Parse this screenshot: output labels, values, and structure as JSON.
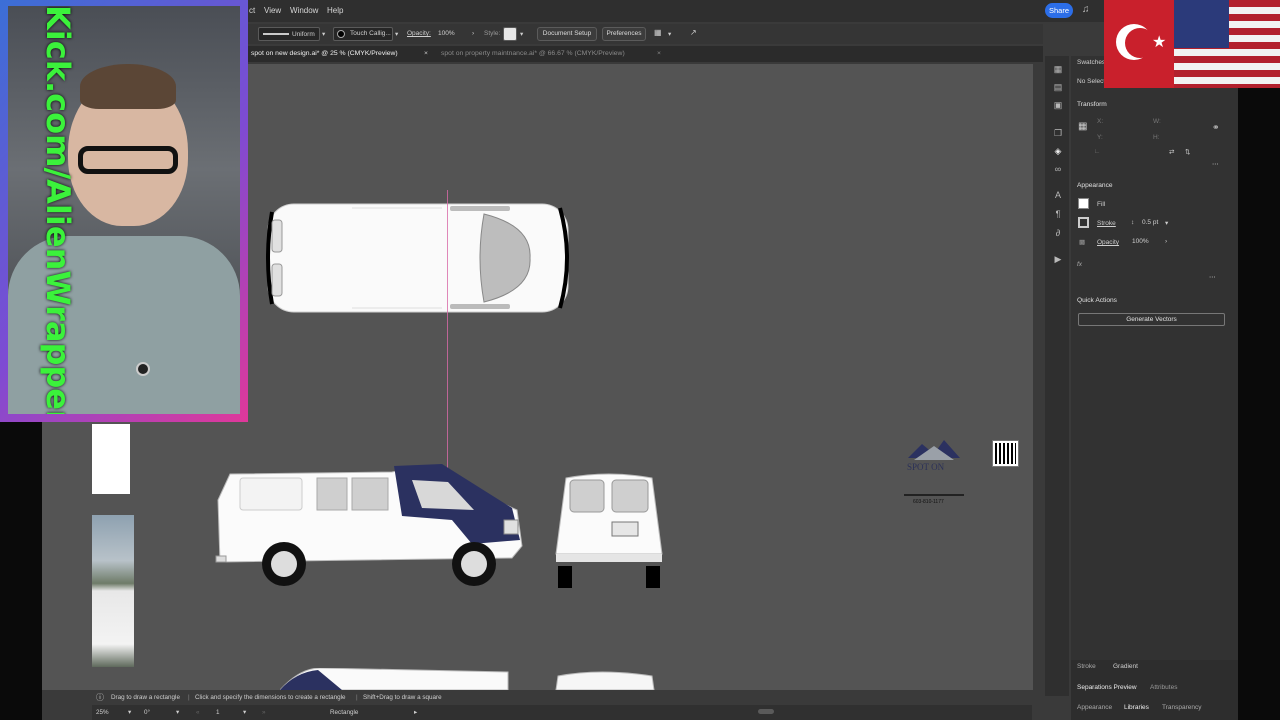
{
  "menu": {
    "items": [
      "ct",
      "View",
      "Window",
      "Help"
    ],
    "share_label": "Share"
  },
  "control_bar": {
    "stroke_profile": "Uniform",
    "brush": "Touch Callig...",
    "opacity_label": "Opacity:",
    "opacity_value": "100%",
    "style_label": "Style:",
    "document_setup": "Document Setup",
    "preferences": "Preferences"
  },
  "tabs": [
    {
      "label": "spot on new design.ai* @ 25 % (CMYK/Preview)",
      "active": true
    },
    {
      "label": "spot on property maintnance.ai* @ 66.67 % (CMYK/Preview)",
      "active": false
    }
  ],
  "hint_bar": {
    "items": [
      "Drag to draw a rectangle",
      "Click and specify the dimensions to create a rectangle",
      "Shift+Drag to draw a square"
    ]
  },
  "status_bar": {
    "zoom": "25%",
    "rotation": "0°",
    "artboard": "1",
    "tool": "Rectangle"
  },
  "panel": {
    "swatches_tab": "Swatches",
    "no_selection": "No Select",
    "transform_title": "Transform",
    "appearance_title": "Appearance",
    "fill_label": "Fill",
    "stroke_label": "Stroke",
    "stroke_value": "0.5 pt",
    "opacity_label": "Opacity",
    "opacity_value": "100%",
    "fx_label": "fx",
    "quick_actions_title": "Quick Actions",
    "generate_vectors": "Generate Vectors",
    "bottom_tabs_row1": [
      "Stroke",
      "Gradient"
    ],
    "bottom_tabs_row2": [
      "Separations Preview",
      "Attributes"
    ],
    "bottom_tabs_row3": [
      "Appearance",
      "Libraries",
      "Transparency"
    ]
  },
  "overlay": {
    "stream_text": "Kick.com/AlienWrapper"
  },
  "artwork": {
    "logo_title": "SPOT ON",
    "logo_phone": "603-810-1177"
  },
  "colors": {
    "share_blue": "#2c6ee8",
    "canvas_gray": "#545454",
    "guide_magenta": "#d86aa8",
    "brand_navy": "#2b3160",
    "kick_green": "#3bf23b"
  }
}
